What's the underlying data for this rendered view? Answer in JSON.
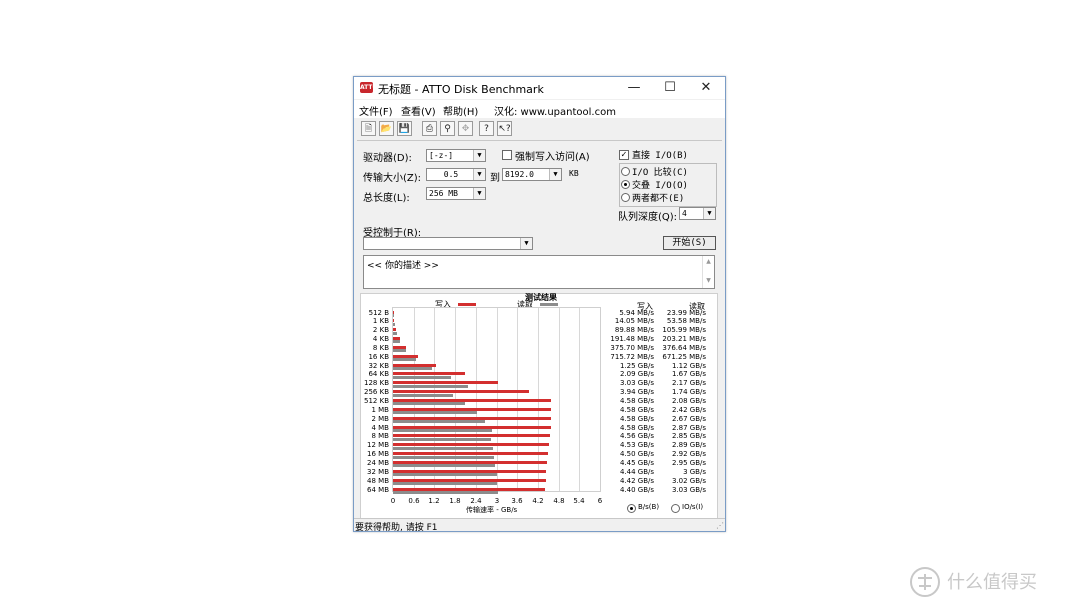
{
  "window": {
    "title": "无标题 - ATTO Disk Benchmark"
  },
  "menu": {
    "items": [
      "文件(F)",
      "查看(V)",
      "帮助(H)",
      "汉化: www.upantool.com"
    ]
  },
  "toolbar": {
    "icons": [
      "new-icon",
      "open-icon",
      "save-icon",
      "print-icon",
      "print-preview-icon",
      "move-icon",
      "help-icon",
      "context-help-icon"
    ]
  },
  "settings": {
    "drive_label": "驱动器(D):",
    "drive_value": "[-z-]",
    "force_write_label": "强制写入访问(A)",
    "force_write_checked": false,
    "direct_io_label": "直接 I/O(B)",
    "direct_io_checked": true,
    "transfer_label": "传输大小(Z):",
    "transfer_from": "0.5",
    "transfer_to_label": "到",
    "transfer_to": "8192.0",
    "transfer_unit": "KB",
    "total_label": "总长度(L):",
    "total_value": "256 MB",
    "io_options": [
      "I/O 比较(C)",
      "交叠 I/O(O)",
      "两者都不(E)"
    ],
    "io_selected": 1,
    "queue_label": "队列深度(Q):",
    "queue_value": "4",
    "controlled_label": "受控制于(R):",
    "controlled_value": "",
    "start_label": "开始(S)",
    "description": "<<  你的描述   >>"
  },
  "results": {
    "title": "测试结果",
    "write_header": "写入",
    "read_header": "读取",
    "units_options": [
      "B/s(B)",
      "IO/s(I)"
    ],
    "units_selected": 0
  },
  "chart_data": {
    "type": "bar",
    "orientation": "horizontal",
    "title": "测试结果",
    "xlabel": "传输速率 - GB/s",
    "xlim": [
      0,
      6
    ],
    "xticks": [
      "0",
      "0.6",
      "1.2",
      "1.8",
      "2.4",
      "3",
      "3.6",
      "4.2",
      "4.8",
      "5.4",
      "6"
    ],
    "categories": [
      "512 B",
      "1 KB",
      "2 KB",
      "4 KB",
      "8 KB",
      "16 KB",
      "32 KB",
      "64 KB",
      "128 KB",
      "256 KB",
      "512 KB",
      "1 MB",
      "2 MB",
      "4 MB",
      "8 MB",
      "12 MB",
      "16 MB",
      "24 MB",
      "32 MB",
      "48 MB",
      "64 MB"
    ],
    "series": [
      {
        "name": "写入",
        "color": "#d32f2f",
        "values": [
          0.00594,
          0.01405,
          0.08988,
          0.19148,
          0.3757,
          0.71572,
          1.25,
          2.09,
          3.03,
          3.94,
          4.58,
          4.58,
          4.58,
          4.58,
          4.56,
          4.53,
          4.5,
          4.45,
          4.44,
          4.42,
          4.4
        ],
        "labels": [
          "5.94 MB/s",
          "14.05 MB/s",
          "89.88 MB/s",
          "191.48 MB/s",
          "375.70 MB/s",
          "715.72 MB/s",
          "1.25 GB/s",
          "2.09 GB/s",
          "3.03 GB/s",
          "3.94 GB/s",
          "4.58 GB/s",
          "4.58 GB/s",
          "4.58 GB/s",
          "4.58 GB/s",
          "4.56 GB/s",
          "4.53 GB/s",
          "4.50 GB/s",
          "4.45 GB/s",
          "4.44 GB/s",
          "4.42 GB/s",
          "4.40 GB/s"
        ]
      },
      {
        "name": "读取",
        "color": "#8c8c8c",
        "values": [
          0.02399,
          0.05358,
          0.10599,
          0.20321,
          0.37664,
          0.67125,
          1.12,
          1.67,
          2.17,
          1.74,
          2.08,
          2.42,
          2.67,
          2.87,
          2.85,
          2.89,
          2.92,
          2.95,
          3,
          3.02,
          3.03
        ],
        "labels": [
          "23.99 MB/s",
          "53.58 MB/s",
          "105.99 MB/s",
          "203.21 MB/s",
          "376.64 MB/s",
          "671.25 MB/s",
          "1.12 GB/s",
          "1.67 GB/s",
          "2.17 GB/s",
          "1.74 GB/s",
          "2.08 GB/s",
          "2.42 GB/s",
          "2.67 GB/s",
          "2.87 GB/s",
          "2.85 GB/s",
          "2.89 GB/s",
          "2.92 GB/s",
          "2.95 GB/s",
          "3 GB/s",
          "3.02 GB/s",
          "3.03 GB/s"
        ]
      }
    ]
  },
  "statusbar": {
    "text": "要获得帮助, 请按 F1"
  },
  "watermark": {
    "text": "什么值得买",
    "icon": "watermark-logo-icon"
  }
}
